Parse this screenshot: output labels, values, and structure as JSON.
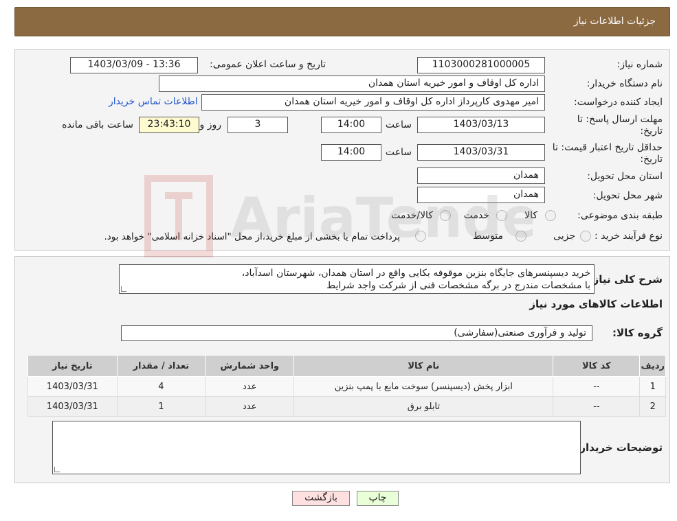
{
  "header": {
    "title": "جزئیات اطلاعات نیاز"
  },
  "form": {
    "need_number_label": "شماره نیاز:",
    "need_number": "1103000281000005",
    "announce_label": "تاریخ و ساعت اعلان عمومی:",
    "announce_value": "1403/03/09 - 13:36",
    "buyer_org_label": "نام دستگاه خریدار:",
    "buyer_org": "اداره کل اوقاف و امور خیریه استان همدان",
    "requester_label": "ایجاد کننده درخواست:",
    "requester": "امیر مهدوی کارپرداز اداره کل اوقاف و امور خیریه استان همدان",
    "contact_link": "اطلاعات تماس خریدار",
    "deadline_label": "مهلت ارسال پاسخ: تا تاریخ:",
    "deadline_date": "1403/03/13",
    "time_label": "ساعت",
    "deadline_time": "14:00",
    "days_value": "3",
    "days_label": "روز و",
    "remaining_value": "23:43:10",
    "remaining_label": "ساعت باقی مانده",
    "validity_label": "حداقل تاریخ اعتبار قیمت: تا تاریخ:",
    "validity_date": "1403/03/31",
    "validity_time": "14:00",
    "province_label": "استان محل تحویل:",
    "province": "همدان",
    "city_label": "شهر محل تحویل:",
    "city": "همدان",
    "category_label": "طبقه بندی موضوعی:",
    "category_options": [
      "کالا",
      "خدمت",
      "کالا/خدمت"
    ],
    "process_label": "نوع فرآیند خرید :",
    "process_options": [
      "جزیی",
      "متوسط"
    ],
    "payment_note": "پرداخت تمام یا بخشی از مبلغ خرید،از محل \"اسناد خزانه اسلامی\" خواهد بود."
  },
  "details": {
    "description_label": "شرح کلی نیاز:",
    "description_line1": "خرید دیسپنسرهای جایگاه بنزین موقوفه بکایی واقع در استان همدان، شهرستان اسدآباد،",
    "description_line2": "با مشخصات مندرج در برگه مشخصات فنی از شرکت واجد شرایط",
    "goods_info_title": "اطلاعات کالاهای مورد نیاز",
    "goods_group_label": "گروه کالا:",
    "goods_group": "تولید و فرآوری صنعتی(سفارشی)",
    "table": {
      "headers": [
        "ردیف",
        "کد کالا",
        "نام کالا",
        "واحد شمارش",
        "تعداد / مقدار",
        "تاریخ نیاز"
      ],
      "rows": [
        [
          "1",
          "--",
          "ابزار پخش (دیسپنسر) سوخت مایع با پمپ بنزین",
          "عدد",
          "4",
          "1403/03/31"
        ],
        [
          "2",
          "--",
          "تابلو برق",
          "عدد",
          "1",
          "1403/03/31"
        ]
      ]
    },
    "buyer_notes_label": "توضیحات خریدار:"
  },
  "buttons": {
    "print": "چاپ",
    "back": "بازگشت"
  },
  "watermark": "AriaTender.neT",
  "colors": {
    "header_bg": "#8b6a42",
    "print_btn": "#e8ffd8",
    "back_btn": "#ffe0e0",
    "remaining_bg": "#fffbd0"
  }
}
